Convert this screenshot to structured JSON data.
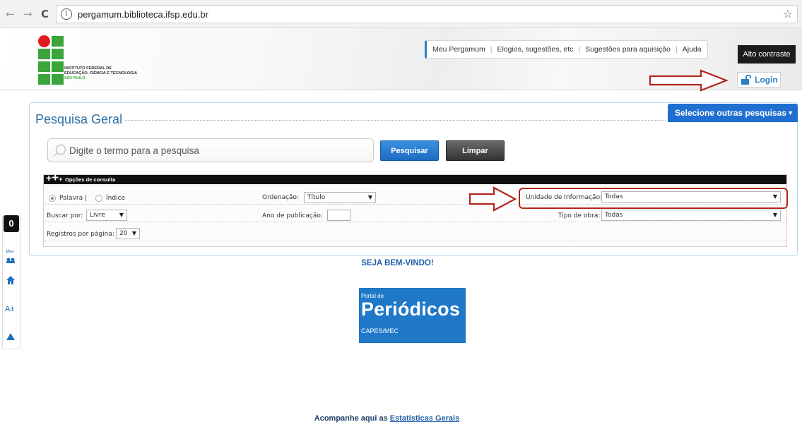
{
  "browser": {
    "url": "pergamum.biblioteca.ifsp.edu.br",
    "back_icon": "←",
    "forward_icon": "→",
    "reload_icon": "C",
    "star_icon": "☆"
  },
  "logo": {
    "line1": "INSTITUTO FEDERAL DE",
    "line2": "EDUCAÇÃO, CIÊNCIA E TECNOLOGIA",
    "line3": "SÃO PAULO",
    "colors": {
      "green": "#3aa53a",
      "red": "#e11b22"
    }
  },
  "topnav": {
    "items": [
      "Meu Pergamum",
      "Elogios, sugestões, etc",
      "Sugestões para aquisição",
      "Ajuda"
    ],
    "alto_contraste": "Alto contraste",
    "login": "Login"
  },
  "sidebar": {
    "contrast": "0",
    "meu": "Meu",
    "font": "A±"
  },
  "search": {
    "title": "Pesquisa Geral",
    "other_searches": "Selecione outras pesquisas",
    "placeholder": "Digite o termo para a pesquisa",
    "btn_search": "Pesquisar",
    "btn_clear": "Limpar"
  },
  "options": {
    "header": "Opções de consulta",
    "radio_palavra": "Palavra |",
    "radio_indice": "Índice",
    "buscar_por_label": "Buscar por:",
    "buscar_por_value": "Livre",
    "registros_label": "Registros por página:",
    "registros_value": "20",
    "ordenacao_label": "Ordenação:",
    "ordenacao_value": "Título",
    "ano_label": "Ano de publicação:",
    "unidade_label": "Unidade de Informação:",
    "unidade_value": "Todas",
    "tipo_label": "Tipo de obra:",
    "tipo_value": "Todas"
  },
  "welcome": "SEJA BEM-VINDO!",
  "periodicos": {
    "small": "Portal de",
    "big": "Periódicos",
    "sub": "CAPES/MEC"
  },
  "footer": {
    "text": "Acompanhe aqui as",
    "link": "Estatísticas Gerais"
  },
  "colors": {
    "accent_blue": "#1f6fd0",
    "title_blue": "#2c6fa7",
    "highlight_red": "#b3261e"
  }
}
